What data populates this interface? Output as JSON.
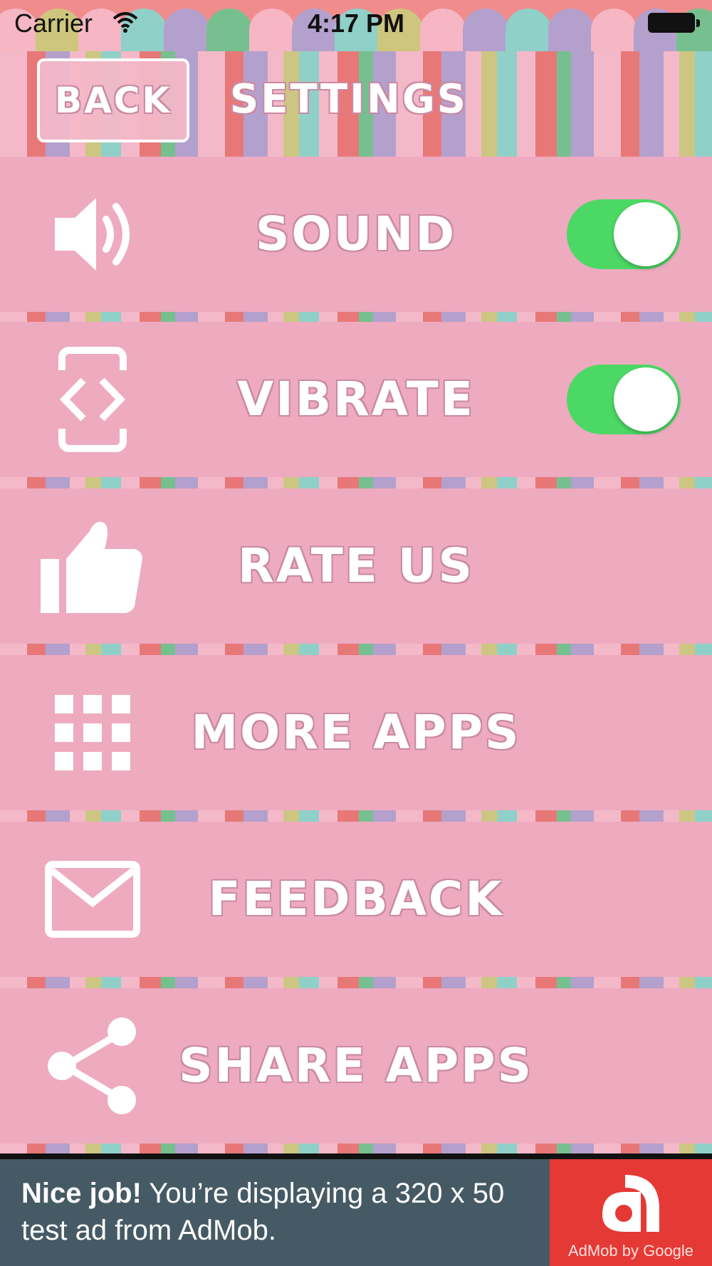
{
  "status_bar": {
    "carrier": "Carrier",
    "time": "4:17 PM"
  },
  "header": {
    "back_label": "BACK",
    "title": "SETTINGS"
  },
  "rows": [
    {
      "label": "SOUND",
      "icon": "speaker-icon",
      "toggle": true,
      "enabled": true
    },
    {
      "label": "VIBRATE",
      "icon": "vibrate-phone-icon",
      "toggle": true,
      "enabled": true
    },
    {
      "label": "RATE US",
      "icon": "thumbs-up-icon"
    },
    {
      "label": "MORE APPS",
      "icon": "grid-icon"
    },
    {
      "label": "FEEDBACK",
      "icon": "envelope-icon"
    },
    {
      "label": "SHARE APPS",
      "icon": "share-icon"
    }
  ],
  "ad": {
    "headline": "Nice job!",
    "body": " You’re displaying a 320 x 50 test ad from AdMob.",
    "logo_text": "AdMob by Google"
  },
  "colors": {
    "row_bg": "#eeaabf",
    "toggle_on": "#4cd864",
    "ad_bg": "#455a64",
    "ad_logo_bg": "#e53935"
  }
}
